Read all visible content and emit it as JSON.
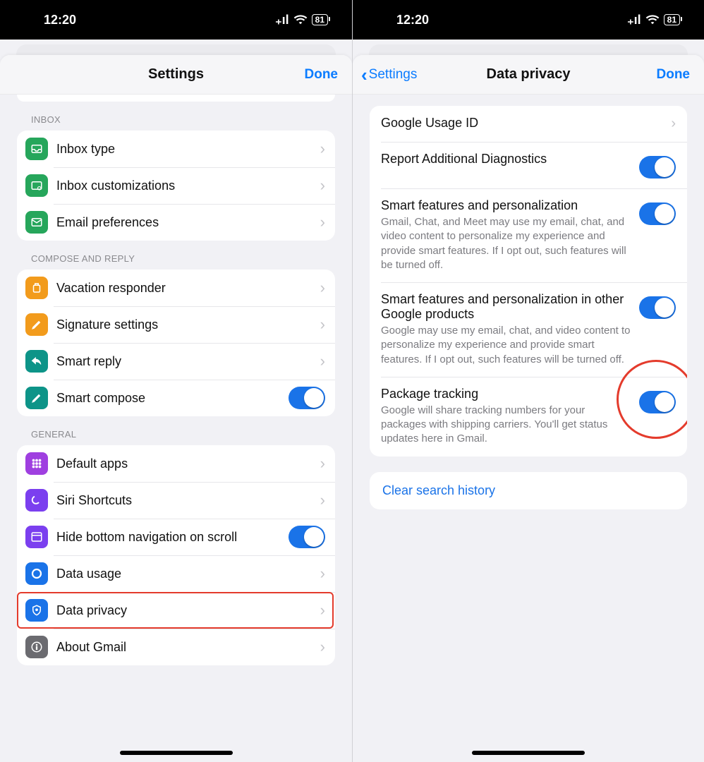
{
  "status": {
    "time": "12:20",
    "battery": "81"
  },
  "left": {
    "header": {
      "title": "Settings",
      "done": "Done"
    },
    "sections": [
      {
        "label": "INBOX",
        "rows": [
          {
            "id": "inbox-type",
            "label": "Inbox type",
            "icon": "tray",
            "color": "green",
            "kind": "nav"
          },
          {
            "id": "inbox-custom",
            "label": "Inbox customizations",
            "icon": "tray-gear",
            "color": "green",
            "kind": "nav"
          },
          {
            "id": "email-prefs",
            "label": "Email preferences",
            "icon": "mail",
            "color": "green",
            "kind": "nav"
          }
        ]
      },
      {
        "label": "COMPOSE AND REPLY",
        "rows": [
          {
            "id": "vacation",
            "label": "Vacation responder",
            "icon": "luggage",
            "color": "orange",
            "kind": "nav"
          },
          {
            "id": "signature",
            "label": "Signature settings",
            "icon": "pencil",
            "color": "orange",
            "kind": "nav"
          },
          {
            "id": "smart-reply",
            "label": "Smart reply",
            "icon": "reply",
            "color": "teal",
            "kind": "nav"
          },
          {
            "id": "smart-compose",
            "label": "Smart compose",
            "icon": "pencil",
            "color": "teal",
            "kind": "toggle",
            "on": true
          }
        ]
      },
      {
        "label": "GENERAL",
        "rows": [
          {
            "id": "default-apps",
            "label": "Default apps",
            "icon": "grid",
            "color": "purple",
            "kind": "nav"
          },
          {
            "id": "siri",
            "label": "Siri Shortcuts",
            "icon": "siri",
            "color": "violet",
            "kind": "nav"
          },
          {
            "id": "hide-nav",
            "label": "Hide bottom navigation on scroll",
            "icon": "window",
            "color": "violet",
            "kind": "toggle",
            "on": true
          },
          {
            "id": "data-usage",
            "label": "Data usage",
            "icon": "circle",
            "color": "blue",
            "kind": "nav"
          },
          {
            "id": "data-privacy",
            "label": "Data privacy",
            "icon": "shield",
            "color": "blue",
            "kind": "nav",
            "highlight": true
          },
          {
            "id": "about",
            "label": "About Gmail",
            "icon": "info",
            "color": "gray",
            "kind": "nav"
          }
        ]
      }
    ]
  },
  "right": {
    "header": {
      "back": "Settings",
      "title": "Data privacy",
      "done": "Done"
    },
    "rows": [
      {
        "id": "usage-id",
        "title": "Google Usage ID",
        "kind": "nav"
      },
      {
        "id": "diagnostics",
        "title": "Report Additional Diagnostics",
        "kind": "toggle",
        "on": true
      },
      {
        "id": "smart-gmail",
        "title": "Smart features and personalization",
        "sub": "Gmail, Chat, and Meet may use my email, chat, and video content to personalize my experience and provide smart features. If I opt out, such features will be turned off.",
        "kind": "toggle",
        "on": true
      },
      {
        "id": "smart-other",
        "title": "Smart features and personalization in other Google products",
        "sub": "Google may use my email, chat, and video content to personalize my experience and provide smart features. If I opt out, such features will be turned off.",
        "kind": "toggle",
        "on": true
      },
      {
        "id": "package-tracking",
        "title": "Package tracking",
        "sub": "Google will share tracking numbers for your packages with shipping carriers. You'll get status updates here in Gmail.",
        "kind": "toggle",
        "on": true,
        "circle": true
      }
    ],
    "action": "Clear search history"
  }
}
